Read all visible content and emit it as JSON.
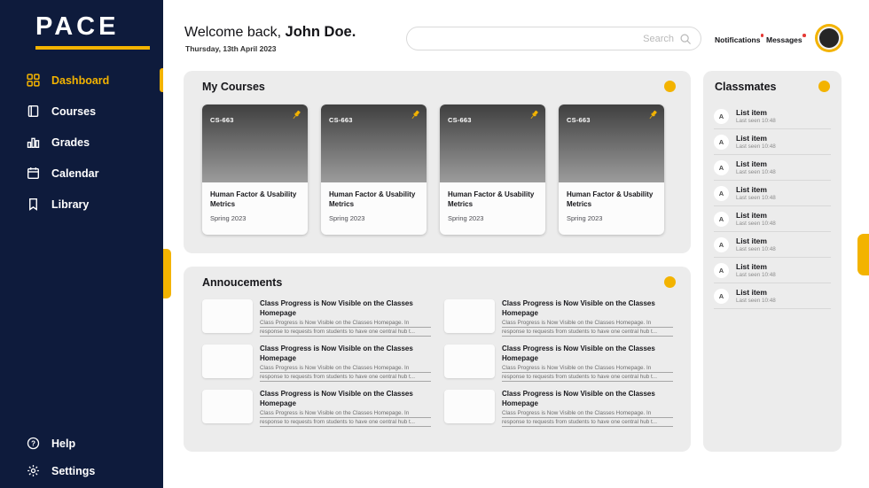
{
  "colors": {
    "sidebar_navy": "#0E1B3C",
    "accent_yellow": "#F3B300",
    "panel_gray": "#ECECEC",
    "notification_red": "#E53935",
    "card_header_dark": "#3F3F3F",
    "card_header_light": "#9C9C9C"
  },
  "sidebar": {
    "logo": "PACE",
    "items": [
      {
        "label": "Dashboard",
        "icon": "dashboard-icon",
        "active": true
      },
      {
        "label": "Courses",
        "icon": "courses-icon",
        "active": false
      },
      {
        "label": "Grades",
        "icon": "grades-icon",
        "active": false
      },
      {
        "label": "Calendar",
        "icon": "calendar-icon",
        "active": false
      },
      {
        "label": "Library",
        "icon": "library-icon",
        "active": false
      }
    ],
    "bottom_items": [
      {
        "label": "Help",
        "icon": "help-icon"
      },
      {
        "label": "Settings",
        "icon": "settings-icon"
      }
    ]
  },
  "header": {
    "greeting_prefix": "Welcome back,",
    "user_name": "John Doe.",
    "date": "Thursday, 13th April 2023",
    "search": {
      "placeholder": "Search",
      "icon": "search-icon"
    },
    "notifications_label": "Notifications",
    "messages_label": "Messages"
  },
  "courses": {
    "title": "My Courses",
    "cards": [
      {
        "code": "CS-663",
        "title": "Human Factor & Usability Metrics",
        "term": "Spring 2023"
      },
      {
        "code": "CS-663",
        "title": "Human Factor & Usability Metrics",
        "term": "Spring 2023"
      },
      {
        "code": "CS-663",
        "title": "Human Factor & Usability Metrics",
        "term": "Spring 2023"
      },
      {
        "code": "CS-663",
        "title": "Human Factor & Usability Metrics",
        "term": "Spring 2023"
      }
    ]
  },
  "announcements": {
    "title": "Annoucements",
    "items": [
      {
        "title": "Class Progress is Now Visible on the Classes Homepage",
        "body": "Class Progress is Now Visible on the Classes Homepage. In response to requests from students to have one central hub t..."
      },
      {
        "title": "Class Progress is Now Visible on the Classes Homepage",
        "body": "Class Progress is Now Visible on the Classes Homepage. In response to requests from students to have one central hub t..."
      },
      {
        "title": "Class Progress is Now Visible on the Classes Homepage",
        "body": "Class Progress is Now Visible on the Classes Homepage. In response to requests from students to have one central hub t..."
      },
      {
        "title": "Class Progress is Now Visible on the Classes Homepage",
        "body": "Class Progress is Now Visible on the Classes Homepage. In response to requests from students to have one central hub t..."
      },
      {
        "title": "Class Progress is Now Visible on the Classes Homepage",
        "body": "Class Progress is Now Visible on the Classes Homepage. In response to requests from students to have one central hub t..."
      },
      {
        "title": "Class Progress is Now Visible on the Classes Homepage",
        "body": "Class Progress is Now Visible on the Classes Homepage. In response to requests from students to have one central hub t..."
      }
    ]
  },
  "classmates": {
    "title": "Classmates",
    "items": [
      {
        "initial": "A",
        "name": "List item",
        "status": "Last seen 10:48"
      },
      {
        "initial": "A",
        "name": "List item",
        "status": "Last seen 10:48"
      },
      {
        "initial": "A",
        "name": "List item",
        "status": "Last seen 10:48"
      },
      {
        "initial": "A",
        "name": "List item",
        "status": "Last seen 10:48"
      },
      {
        "initial": "A",
        "name": "List item",
        "status": "Last seen 10:48"
      },
      {
        "initial": "A",
        "name": "List item",
        "status": "Last seen 10:48"
      },
      {
        "initial": "A",
        "name": "List item",
        "status": "Last seen 10:48"
      },
      {
        "initial": "A",
        "name": "List item",
        "status": "Last seen 10:48"
      }
    ]
  }
}
